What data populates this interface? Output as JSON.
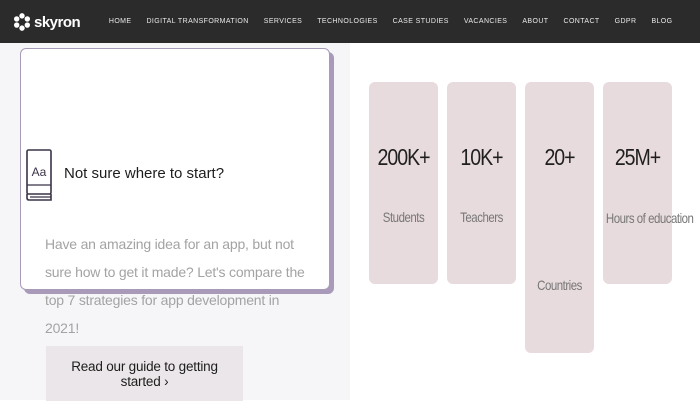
{
  "brand": {
    "name": "skyron",
    "icon": "gear-flower-logo-icon"
  },
  "nav": {
    "items": [
      {
        "label": "HOME"
      },
      {
        "label": "DIGITAL TRANSFORMATION"
      },
      {
        "label": "SERVICES"
      },
      {
        "label": "TECHNOLOGIES"
      },
      {
        "label": "CASE STUDIES"
      },
      {
        "label": "VACANCIES"
      },
      {
        "label": "ABOUT"
      },
      {
        "label": "CONTACT"
      },
      {
        "label": "GDPR"
      },
      {
        "label": "BLOG"
      }
    ]
  },
  "card": {
    "icon": "dictionary-book-icon",
    "icon_text": "Aa",
    "title": "Not sure where to start?",
    "text": "Have an amazing idea for an app, but not sure how to get it made? Let's compare the top 7 strategies for app development in 2021!"
  },
  "cta": {
    "label": "Read our guide to getting started ›"
  },
  "stats": [
    {
      "value": "200K+",
      "label": "Students"
    },
    {
      "value": "10K+",
      "label": "Teachers"
    },
    {
      "value": "20+",
      "label": "Countries"
    },
    {
      "value": "25M+",
      "label": "Hours of education"
    }
  ],
  "colors": {
    "navbar_bg": "#2b2b2b",
    "card_border": "#a89bb8",
    "stat_bg": "#e8dbdd",
    "cta_bg": "#ebe6e9",
    "left_bg": "#f6f6f9"
  }
}
